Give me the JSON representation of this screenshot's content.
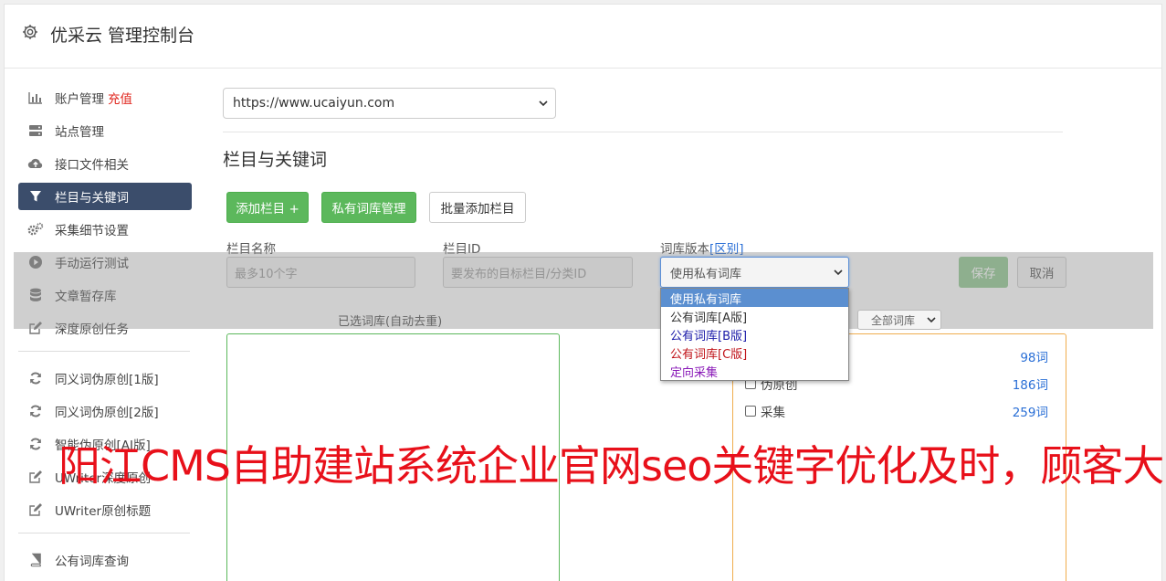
{
  "header": {
    "title": "优采云 管理控制台"
  },
  "sidebar": {
    "group1": [
      {
        "label": "账户管理",
        "badge": "充值",
        "icon": "bar-chart-icon"
      },
      {
        "label": "站点管理",
        "icon": "server-icon"
      },
      {
        "label": "接口文件相关",
        "icon": "cloud-upload-icon"
      },
      {
        "label": "栏目与关键词",
        "icon": "filter-icon",
        "active": true
      },
      {
        "label": "采集细节设置",
        "icon": "cogs-icon"
      },
      {
        "label": "手动运行测试",
        "icon": "play-circle-icon"
      },
      {
        "label": "文章暂存库",
        "icon": "database-icon"
      },
      {
        "label": "深度原创任务",
        "icon": "edit-icon"
      }
    ],
    "group2": [
      {
        "label": "同义词伪原创[1版]",
        "icon": "refresh-icon"
      },
      {
        "label": "同义词伪原创[2版]",
        "icon": "refresh-icon"
      },
      {
        "label": "智能伪原创[AI版]",
        "icon": "refresh-icon"
      },
      {
        "label": "UWriter深度原创",
        "icon": "edit-icon"
      },
      {
        "label": "UWriter原创标题",
        "icon": "edit-icon"
      }
    ],
    "group3": [
      {
        "label": "公有词库查询",
        "icon": "book-icon"
      }
    ]
  },
  "main": {
    "site_select": "https://www.ucaiyun.com",
    "section_title": "栏目与关键词",
    "buttons": {
      "add_column": "添加栏目 +",
      "private_lib": "私有词库管理",
      "batch_add": "批量添加栏目"
    },
    "form": {
      "col_name_label": "栏目名称",
      "col_name_placeholder": "最多10个字",
      "col_id_label": "栏目ID",
      "col_id_placeholder": "要发布的目标栏目/分类ID",
      "lib_version_label": "词库版本",
      "lib_version_link": "[区别]",
      "lib_version_value": "使用私有词库",
      "save": "保存",
      "cancel": "取消"
    },
    "dropdown_options": [
      {
        "label": "使用私有词库",
        "color": "#ffffff",
        "selected": true
      },
      {
        "label": "公有词库[A版]",
        "color": "#333333"
      },
      {
        "label": "公有词库[B版]",
        "color": "#1a1aa8"
      },
      {
        "label": "公有词库[C版]",
        "color": "#c0141a"
      },
      {
        "label": "定向采集",
        "color": "#8a1ab8"
      }
    ],
    "selected_lib_label": "已选词库(自动去重)",
    "lib_filter": "全部词库",
    "libraries": [
      {
        "label": "",
        "count": "98词"
      },
      {
        "label": "伪原创",
        "count": "186词"
      },
      {
        "label": "采集",
        "count": "259词"
      }
    ]
  },
  "watermark": "阳江CMS自助建站系统企业官网seo关键字优化及时，顾客大"
}
